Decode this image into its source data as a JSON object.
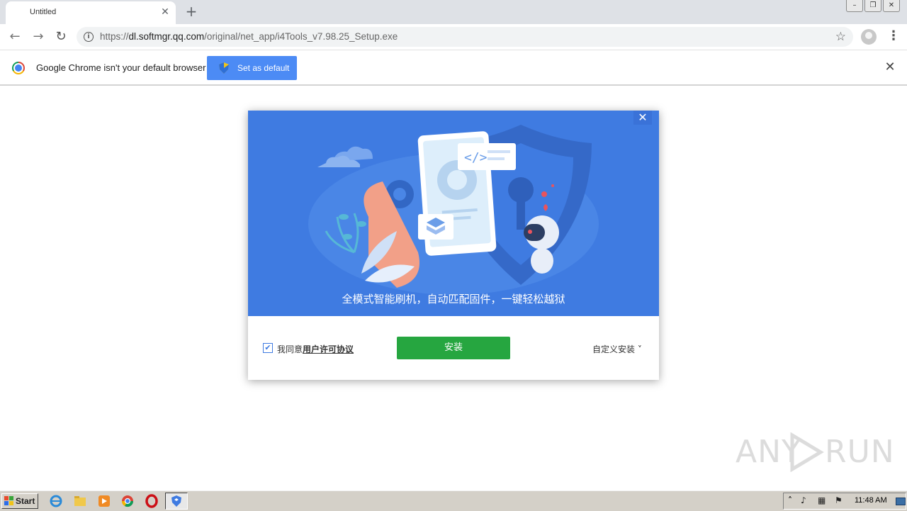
{
  "browser": {
    "tab": {
      "title": "Untitled",
      "close": "✕"
    },
    "new_tab": "+",
    "window_controls": [
      "–",
      "❐",
      "✕"
    ],
    "url": {
      "scheme": "https://",
      "host": "dl.softmgr.qq.com",
      "path": "/original/net_app/i4Tools_v7.98.25_Setup.exe"
    },
    "infobar": {
      "message": "Google Chrome isn't your default browser",
      "button": "Set as default",
      "close": "✕"
    }
  },
  "dialog": {
    "close": "✕",
    "slogan": "全模式智能刷机，自动匹配固件，一键轻松越狱",
    "agree_prefix": "我同意",
    "agree_link": "用户许可协议",
    "agree_checked": true,
    "install_button": "安装",
    "custom_install": "自定义安装 ˅",
    "colors": {
      "banner": "#3f7be1",
      "install": "#26a640"
    }
  },
  "watermark": {
    "left": "ANY",
    "right": "RUN"
  },
  "taskbar": {
    "start": "Start",
    "icons": [
      "ie-icon",
      "explorer-icon",
      "media-player-icon",
      "chrome-icon",
      "opera-icon",
      "installer-icon"
    ],
    "clock": "11:48 AM"
  }
}
